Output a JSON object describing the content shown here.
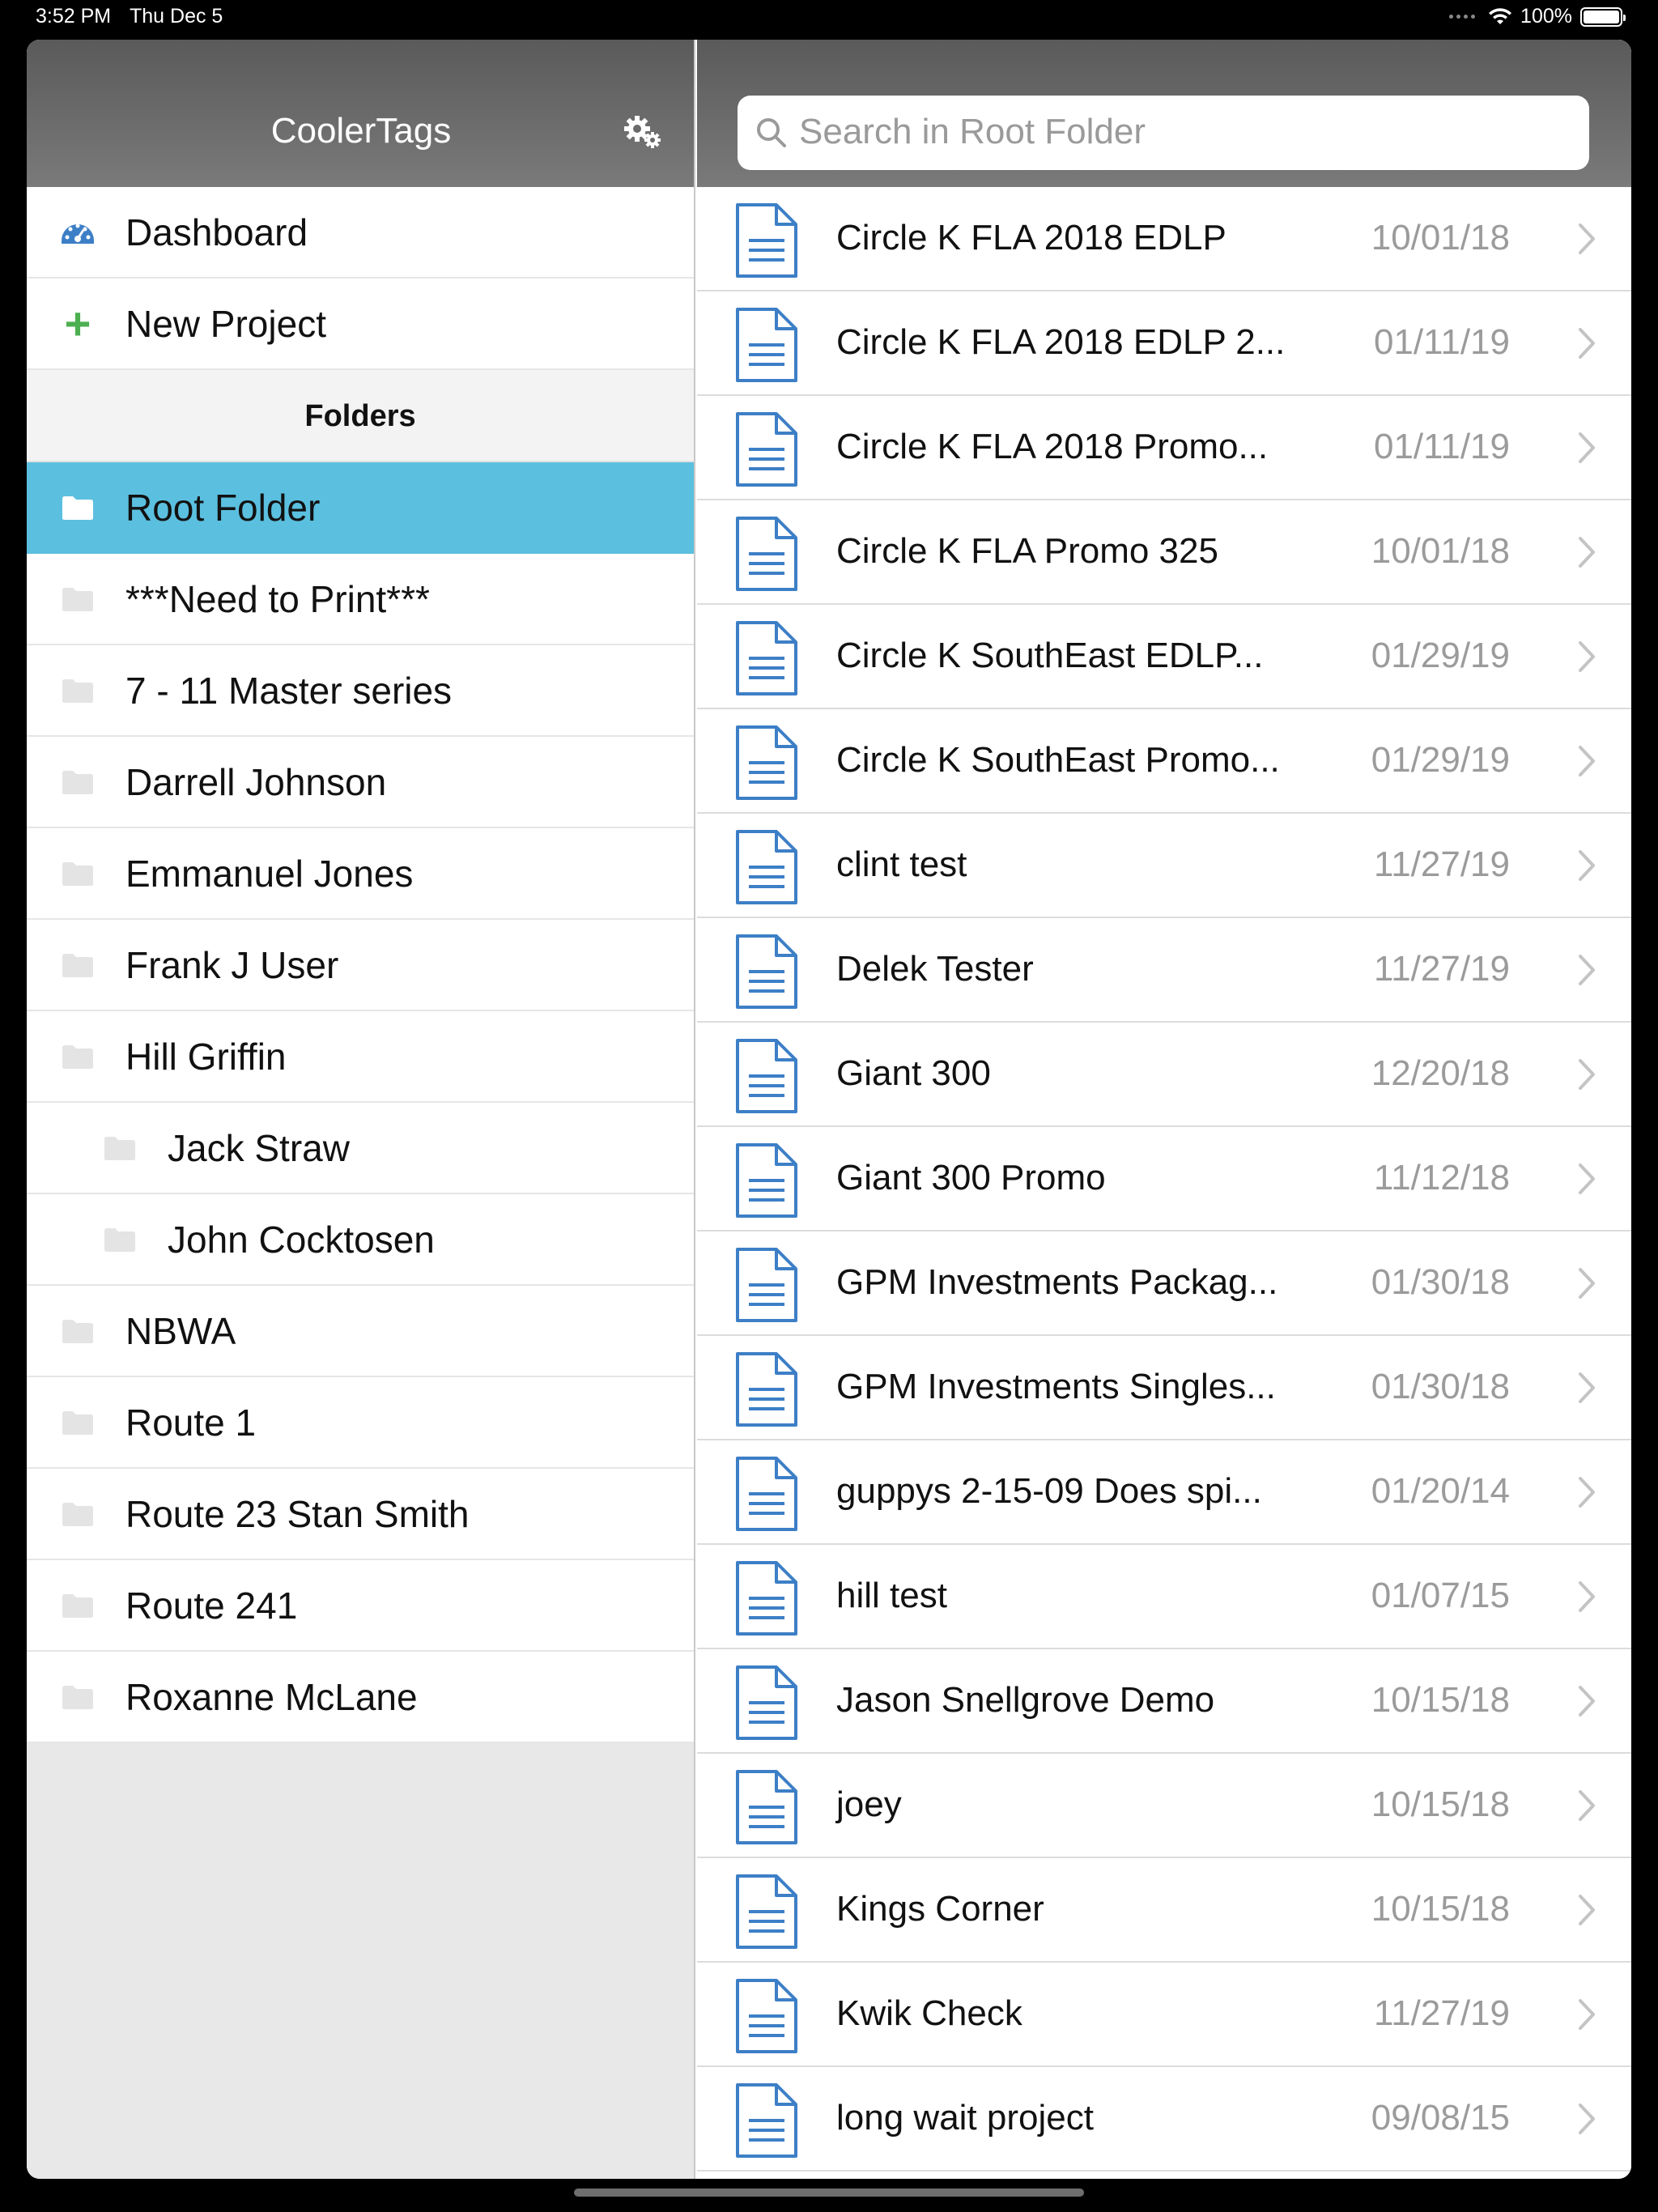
{
  "status": {
    "time": "3:52 PM",
    "date": "Thu Dec 5",
    "battery": "100%"
  },
  "sidebar": {
    "title": "CoolerTags",
    "top_items": [
      {
        "label": "Dashboard",
        "icon": "dashboard-icon"
      },
      {
        "label": "New Project",
        "icon": "plus-icon"
      }
    ],
    "section_label": "Folders",
    "folders": [
      {
        "label": "Root Folder",
        "selected": true,
        "indent": false
      },
      {
        "label": "***Need to Print***",
        "indent": false
      },
      {
        "label": "7 - 11 Master series",
        "indent": false
      },
      {
        "label": "Darrell Johnson",
        "indent": false
      },
      {
        "label": "Emmanuel Jones",
        "indent": false
      },
      {
        "label": "Frank J User",
        "indent": false
      },
      {
        "label": "Hill Griffin",
        "indent": false
      },
      {
        "label": "Jack Straw",
        "indent": true
      },
      {
        "label": "John Cocktosen",
        "indent": true
      },
      {
        "label": "NBWA",
        "indent": false
      },
      {
        "label": "Route 1",
        "indent": false
      },
      {
        "label": "Route 23 Stan Smith",
        "indent": false
      },
      {
        "label": "Route 241",
        "indent": false
      },
      {
        "label": "Roxanne McLane",
        "indent": false
      }
    ]
  },
  "search": {
    "placeholder": "Search in Root Folder"
  },
  "files": [
    {
      "name": "Circle K FLA 2018 EDLP",
      "date": "10/01/18"
    },
    {
      "name": "Circle K FLA 2018 EDLP 2...",
      "date": "01/11/19"
    },
    {
      "name": "Circle K FLA 2018 Promo...",
      "date": "01/11/19"
    },
    {
      "name": "Circle K FLA Promo 325",
      "date": "10/01/18"
    },
    {
      "name": "Circle K SouthEast EDLP...",
      "date": "01/29/19"
    },
    {
      "name": "Circle K SouthEast Promo...",
      "date": "01/29/19"
    },
    {
      "name": "clint test",
      "date": "11/27/19"
    },
    {
      "name": "Delek Tester",
      "date": "11/27/19"
    },
    {
      "name": "Giant 300",
      "date": "12/20/18"
    },
    {
      "name": "Giant 300 Promo",
      "date": "11/12/18"
    },
    {
      "name": "GPM Investments Packag...",
      "date": "01/30/18"
    },
    {
      "name": "GPM Investments Singles...",
      "date": "01/30/18"
    },
    {
      "name": "guppys 2-15-09 Does spi...",
      "date": "01/20/14"
    },
    {
      "name": "hill test",
      "date": "01/07/15"
    },
    {
      "name": "Jason Snellgrove Demo",
      "date": "10/15/18"
    },
    {
      "name": "joey",
      "date": "10/15/18"
    },
    {
      "name": "Kings Corner",
      "date": "10/15/18"
    },
    {
      "name": "Kwik Check",
      "date": "11/27/19"
    },
    {
      "name": "long wait project",
      "date": "09/08/15"
    }
  ],
  "colors": {
    "accent": "#5bbfdf",
    "file_icon": "#3d7fc6",
    "plus": "#4caf50",
    "header": "#6a6a6a"
  }
}
